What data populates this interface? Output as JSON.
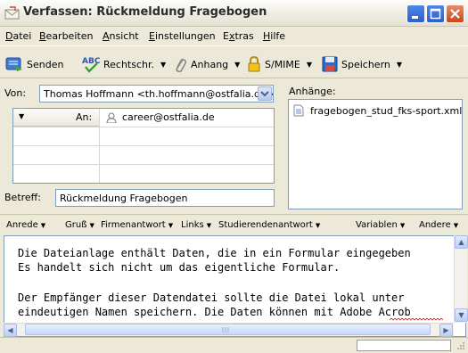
{
  "window": {
    "title": "Verfassen: Rückmeldung Fragebogen"
  },
  "menu": {
    "items": [
      {
        "label": "Datei",
        "accel": "D"
      },
      {
        "label": "Bearbeiten",
        "accel": "B"
      },
      {
        "label": "Ansicht",
        "accel": "A"
      },
      {
        "label": "Einstellungen",
        "accel": "E"
      },
      {
        "label": "Extras",
        "accel": "x"
      },
      {
        "label": "Hilfe",
        "accel": "H"
      }
    ]
  },
  "toolbar": {
    "send_label": "Senden",
    "spell_label": "Rechtschr.",
    "attach_label": "Anhang",
    "smime_label": "S/MIME",
    "save_label": "Speichern"
  },
  "header": {
    "from_label": "Von:",
    "from_value": "Thomas Hoffmann <th.hoffmann@ostfalia.de>",
    "recipient_type": "An:",
    "recipient_address": "career@ostfalia.de",
    "subject_label": "Betreff:",
    "subject_value": "Rückmeldung Fragebogen"
  },
  "attachments": {
    "label": "Anhänge:",
    "items": [
      "fragebogen_stud_fks-sport.xml"
    ]
  },
  "quicktext": {
    "left": [
      "Anrede",
      "Gruß",
      "Firmenantwort",
      "Links",
      "Studierendenantwort"
    ],
    "right": [
      "Variablen",
      "Andere"
    ]
  },
  "body": {
    "lines": [
      "Die Dateianlage enthält Daten, die in ein Formular eingegeben",
      "Es handelt sich nicht um das eigentliche Formular.",
      "",
      "Der Empfänger dieser Datendatei sollte die Datei lokal unter",
      "eindeutigen Namen speichern. Die Daten können mit Adobe Acrob"
    ]
  },
  "colors": {
    "accent": "#2a5ed1",
    "close_button": "#cf4419",
    "window_bg": "#ece9d8"
  }
}
